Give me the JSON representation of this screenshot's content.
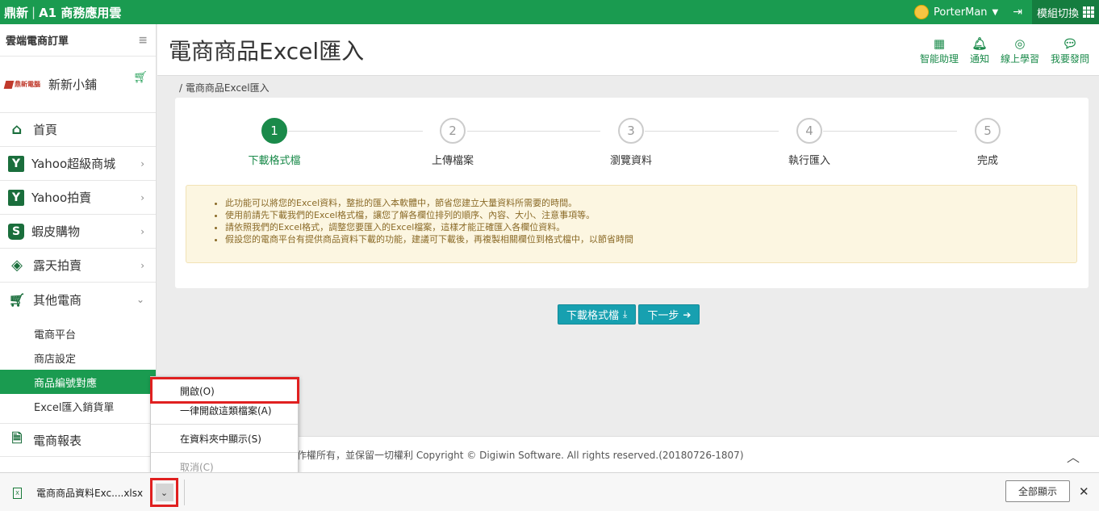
{
  "topbar": {
    "brand_main": "鼎新",
    "brand_sub": "A1 商務應用雲",
    "user": "PorterMan",
    "module_switch": "模組切換"
  },
  "sidebar": {
    "title": "雲端電商訂單",
    "store_logo": "鼎新電腦",
    "store_name": "新新小鋪",
    "items": [
      {
        "label": "首頁",
        "icon": "home-icon"
      },
      {
        "label": "Yahoo超級商城",
        "icon": "yahoo-icon",
        "glyph": "Y"
      },
      {
        "label": "Yahoo拍賣",
        "icon": "yahoo-icon",
        "glyph": "Y"
      },
      {
        "label": "蝦皮購物",
        "icon": "shopee-icon",
        "glyph": "S"
      },
      {
        "label": "露天拍賣",
        "icon": "ruten-icon"
      },
      {
        "label": "其他電商",
        "icon": "cart-icon"
      }
    ],
    "sub_items": [
      "電商平台",
      "商店設定",
      "商品編號對應",
      "Excel匯入銷貨單"
    ],
    "report": "電商報表"
  },
  "header": {
    "title": "電商商品Excel匯入",
    "actions": [
      "智能助理",
      "通知",
      "線上學習",
      "我要發問"
    ]
  },
  "breadcrumb": "/  電商商品Excel匯入",
  "wizard": {
    "steps": [
      {
        "num": "1",
        "label": "下載格式檔"
      },
      {
        "num": "2",
        "label": "上傳檔案"
      },
      {
        "num": "3",
        "label": "瀏覽資料"
      },
      {
        "num": "4",
        "label": "執行匯入"
      },
      {
        "num": "5",
        "label": "完成"
      }
    ],
    "active_step": 1,
    "notices": [
      "此功能可以將您的Excel資料，整批的匯入本軟體中，節省您建立大量資料所需要的時間。",
      "使用前請先下載我們的Excel格式檔，讓您了解各欄位排列的順序、內容、大小、注意事項等。",
      "請依照我們的Excel格式，調整您要匯入的Excel檔案，這樣才能正確匯入各欄位資料。",
      "假設您的電商平台有提供商品資料下載的功能，建議可下載後，再複製相關欄位到格式檔中，以節省時間"
    ],
    "download_btn": "下載格式檔",
    "next_btn": "下一步"
  },
  "footer": {
    "text": "作權所有，並保留一切權利 Copyright © Digiwin Software. All rights reserved.(20180726-1807)"
  },
  "context_menu": {
    "items": [
      "開啟(O)",
      "一律開啟這類檔案(A)",
      "在資料夾中顯示(S)",
      "取消(C)"
    ]
  },
  "download_bar": {
    "filename": "電商商品資料Exc....xlsx",
    "show_all": "全部顯示"
  },
  "colors": {
    "brand_green": "#1a9b50",
    "teal_button": "#17a0b0",
    "highlight_red": "#e02020"
  }
}
